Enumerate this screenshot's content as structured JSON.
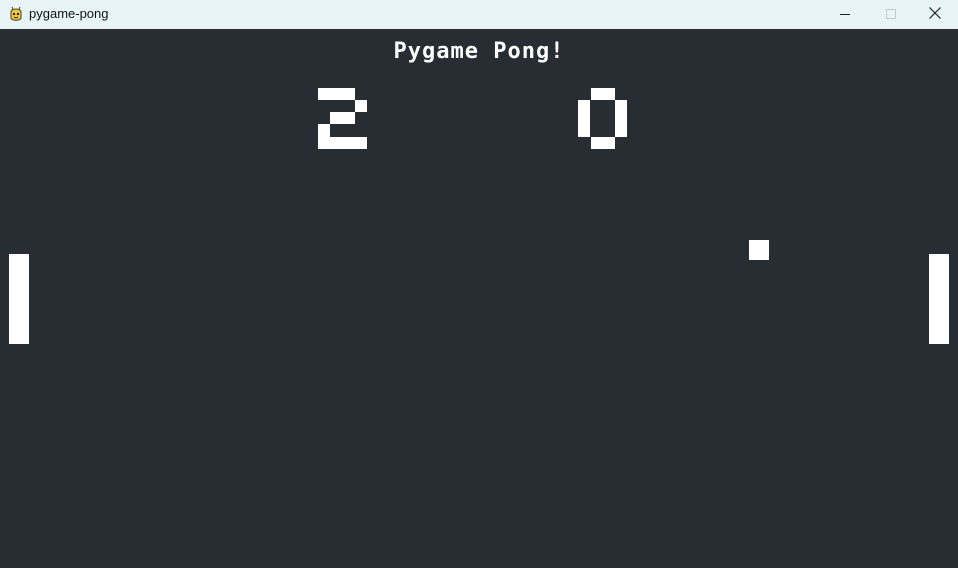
{
  "window": {
    "title": "pygame-pong",
    "icon": "pygame-snake-icon",
    "controls": {
      "minimize": "minimize-icon",
      "maximize": "maximize-icon",
      "close": "close-icon"
    }
  },
  "game": {
    "title": "Pygame Pong!",
    "score_left": "2",
    "score_right": "0"
  },
  "colors": {
    "background": "#282c33",
    "foreground": "#ffffff",
    "titlebar": "#e8f5f7"
  }
}
